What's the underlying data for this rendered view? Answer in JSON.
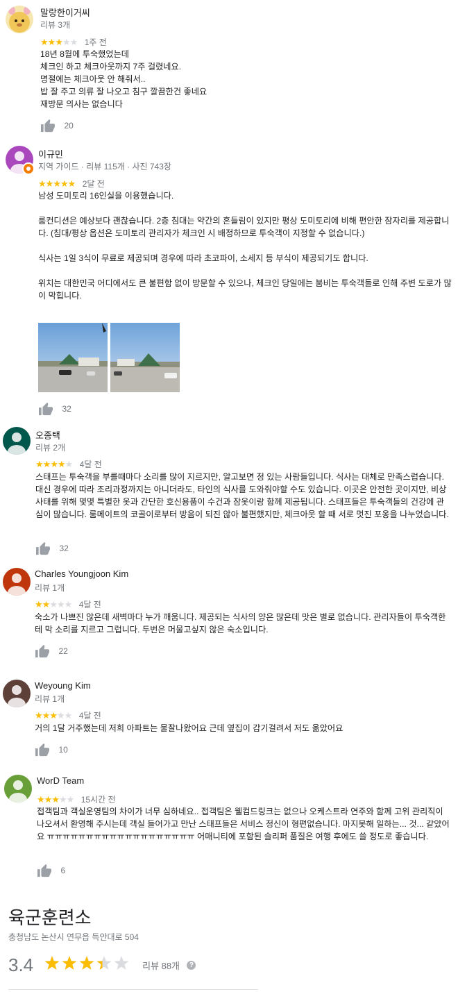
{
  "reviews": [
    {
      "author": "말랑한이거씨",
      "meta": "리뷰 3개",
      "rating": 3,
      "time": "1주 전",
      "text": "18년 8월에 투숙했었는데\n체크인 하고 체크아웃까지 7주 걸렸네요.\n명절에는 체크아웃 안 해줘서..\n밥 잘 주고 의류 잘 나오고 침구 깔끔한건 좋네요\n재방문 의사는 없습니다",
      "likes": "20",
      "avatar_color": "#f3e3a0",
      "avatar_icon": "cartoon-face"
    },
    {
      "author": "이규민",
      "meta": "지역 가이드 · 리뷰 115개 · 사진 743장",
      "rating": 5,
      "time": "2달 전",
      "text": "남성 도미토리 16인실을 이용했습니다.\n\n룸컨디션은 예상보다 괜찮습니다. 2층 침대는 약간의 흔들림이 있지만 평상 도미토리에 비해 편안한 잠자리를 제공합니다. (침대/평상 옵션은 도미토리 관리자가 체크인 시 배정하므로 투숙객이 지정할 수 없습니다.)\n\n식사는 1일 3식이 무료로 제공되며 경우에 따라 초코파이, 소세지 등 부식이 제공되기도 합니다.\n\n위치는 대한민국 어디에서도 큰 불편함 없이 방문할 수 있으나, 체크인 당일에는 붐비는 투숙객들로 인해 주변 도로가 많이 막힙니다.",
      "likes": "32",
      "avatar_color": "#ab47bc",
      "avatar_icon": "person-silhouette",
      "photos": [
        "street-photo-1",
        "street-photo-2"
      ]
    },
    {
      "author": "오종택",
      "meta": "리뷰 2개",
      "rating": 4,
      "time": "4달 전",
      "text": "스태프는 투숙객을 부를때마다 소리를 많이 지르지만, 알고보면 정 있는 사람들입니다. 식사는 대체로 만족스럽습니다. 대신 경우에 따라 조리과정까지는 아니더라도, 타인의 식사를 도와줘야할 수도 있습니다. 이곳은 안전한 곳이지만, 비상사태를 위해 몇몇 특별한 옷과 간단한 호신용품이 수건과 잠옷이랑 함께 제공됩니다. 스태프들은 투숙객들의 건강에 관심이 많습니다. 룸메이트의 코골이로부터 방음이 되진 않아 불편했지만, 체크아웃 할 때 서로 멋진 포옹을 나누었습니다.",
      "likes": "32",
      "avatar_color": "#00574b",
      "avatar_icon": "person-silhouette"
    },
    {
      "author": "Charles Youngjoon Kim",
      "meta": "리뷰 1개",
      "rating": 2,
      "time": "4달 전",
      "text": "숙소가 나쁘진 않은데 새벽마다 누가 깨웁니다. 제공되는 식사의 양은 많은데 맛은 별로 없습니다. 관리자들이 투숙객한테 막 소리를 지르고 그럽니다. 두번은 머물고싶지 않은 숙소입니다.",
      "likes": "22",
      "avatar_color": "#bf360c",
      "avatar_icon": "person-silhouette"
    },
    {
      "author": "Weyoung Kim",
      "meta": "리뷰 1개",
      "rating": 3,
      "time": "4달 전",
      "text": "거의 1달 거주했는데 저희 아파트는 물잘나왔어요 근데 옆집이 감기걸려서 저도 옮았어요",
      "likes": "10",
      "avatar_color": "#5d4037",
      "avatar_icon": "person-silhouette"
    },
    {
      "author": "WorD Team",
      "meta": "",
      "rating": 3,
      "time": "15시간 전",
      "text": "접객팀과 객실운영팀의 차이가 너무 심하네요.. 접객팀은 웰컴드링크는 없으나 오케스트라 연주와 함께 고위 관리직이 나오셔서 환영해 주시는데 객실 들어가고 만난 스태프들은 서비스 정신이 형편없습니다. 마지못해 일하는... 것... 같았어요 ㅠㅠㅠㅠㅠㅠㅠㅠㅠㅠㅠㅠㅠㅠㅠㅠㅠㅠㅠ 어매니티에 포함된 슬리퍼 품질은 여행 후에도 쓸 정도로 좋습니다.",
      "likes": "6",
      "avatar_color": "#689f38",
      "avatar_icon": "person-silhouette"
    }
  ],
  "place": {
    "title": "육군훈련소",
    "address": "충청남도 논산시 연무읍 득안대로 504",
    "score": "3.4",
    "rating_value": 3.4,
    "review_count": "리뷰 88개",
    "help_glyph": "?"
  },
  "colors": {
    "star_on": "#fbbc04",
    "star_off": "#dadce0",
    "meta_text": "#70757a",
    "guide_badge": "#f57c00"
  },
  "icons": {
    "like": "thumbs-up-icon",
    "help": "help-circle-icon",
    "guide": "local-guide-badge-icon"
  }
}
